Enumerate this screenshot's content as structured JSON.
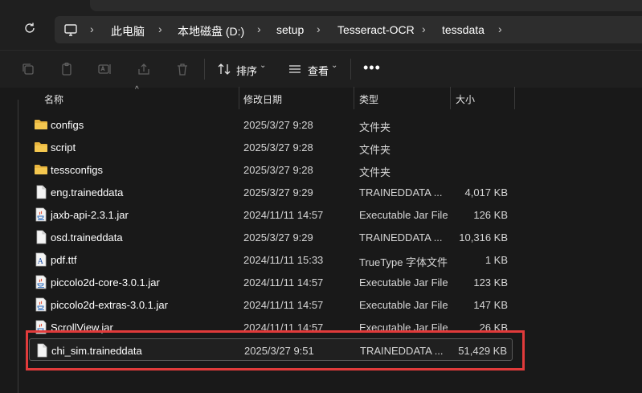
{
  "breadcrumb": [
    {
      "label": "此电脑"
    },
    {
      "label": "本地磁盘 (D:)"
    },
    {
      "label": "setup"
    },
    {
      "label": "Tesseract-OCR"
    },
    {
      "label": "tessdata"
    }
  ],
  "toolbar": {
    "sort_label": "排序",
    "view_label": "查看",
    "more_label": "•••"
  },
  "columns": {
    "name": "名称",
    "date": "修改日期",
    "type": "类型",
    "size": "大小"
  },
  "files": [
    {
      "icon": "folder-icon",
      "name": "configs",
      "date": "2025/3/27 9:28",
      "type": "文件夹",
      "size": ""
    },
    {
      "icon": "folder-icon",
      "name": "script",
      "date": "2025/3/27 9:28",
      "type": "文件夹",
      "size": ""
    },
    {
      "icon": "folder-icon",
      "name": "tessconfigs",
      "date": "2025/3/27 9:28",
      "type": "文件夹",
      "size": ""
    },
    {
      "icon": "file-icon",
      "name": "eng.traineddata",
      "date": "2025/3/27 9:29",
      "type": "TRAINEDDATA ...",
      "size": "4,017 KB"
    },
    {
      "icon": "jar-icon",
      "name": "jaxb-api-2.3.1.jar",
      "date": "2024/11/11 14:57",
      "type": "Executable Jar File",
      "size": "126 KB"
    },
    {
      "icon": "file-icon",
      "name": "osd.traineddata",
      "date": "2025/3/27 9:29",
      "type": "TRAINEDDATA ...",
      "size": "10,316 KB"
    },
    {
      "icon": "font-icon",
      "name": "pdf.ttf",
      "date": "2024/11/11 15:33",
      "type": "TrueType 字体文件",
      "size": "1 KB"
    },
    {
      "icon": "jar-icon",
      "name": "piccolo2d-core-3.0.1.jar",
      "date": "2024/11/11 14:57",
      "type": "Executable Jar File",
      "size": "123 KB"
    },
    {
      "icon": "jar-icon",
      "name": "piccolo2d-extras-3.0.1.jar",
      "date": "2024/11/11 14:57",
      "type": "Executable Jar File",
      "size": "147 KB"
    },
    {
      "icon": "jar-icon",
      "name": "ScrollView.jar",
      "date": "2024/11/11 14:57",
      "type": "Executable Jar File",
      "size": "26 KB"
    },
    {
      "icon": "file-icon",
      "name": "chi_sim.traineddata",
      "date": "2025/3/27 9:51",
      "type": "TRAINEDDATA ...",
      "size": "51,429 KB"
    }
  ],
  "colors": {
    "background": "#191919",
    "folder": "#e8b53e",
    "highlight": "#e13b3b"
  }
}
